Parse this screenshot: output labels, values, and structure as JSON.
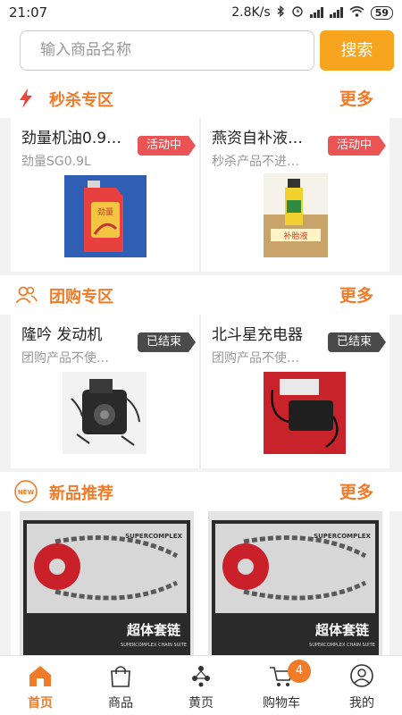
{
  "status_bar": {
    "time": "21:07",
    "speed": "2.8K/s",
    "battery": "59"
  },
  "search": {
    "placeholder": "输入商品名称",
    "button_label": "搜索"
  },
  "flash_sale": {
    "title": "秒杀专区",
    "more": "更多",
    "items": [
      {
        "name": "劲量机油0.9…",
        "subtitle": "劲量SG0.9L",
        "badge": "活动中"
      },
      {
        "name": "燕资自补液…",
        "subtitle": "秒杀产品不进…",
        "badge": "活动中"
      }
    ]
  },
  "group_buy": {
    "title": "团购专区",
    "more": "更多",
    "items": [
      {
        "name": "隆吟 发动机",
        "subtitle": "团购产品不使…",
        "badge": "已结束"
      },
      {
        "name": "北斗星充电器",
        "subtitle": "团购产品不使…",
        "badge": "已结束"
      }
    ]
  },
  "new_products": {
    "title": "新品推荐",
    "more": "更多",
    "icon_text": "NEW",
    "items": [
      {
        "box_title": "超体套链",
        "box_subtitle": "SUPERCOMPLEX CHAIN SUITE",
        "brand": "SUPERCOMPLEX"
      },
      {
        "box_title": "超体套链",
        "box_subtitle": "SUPERCOMPLEX CHAIN SUITE",
        "brand": "SUPERCOMPLEX"
      }
    ]
  },
  "product_labels": {
    "oil_bottle": "劲量",
    "carton": "补胎液"
  },
  "tab_bar": {
    "tabs": [
      {
        "label": "首页",
        "icon": "home-icon",
        "active": true
      },
      {
        "label": "商品",
        "icon": "bag-icon",
        "active": false
      },
      {
        "label": "黄页",
        "icon": "network-icon",
        "active": false
      },
      {
        "label": "购物车",
        "icon": "cart-icon",
        "active": false
      },
      {
        "label": "我的",
        "icon": "user-icon",
        "active": false
      }
    ],
    "cart_count": "4"
  },
  "colors": {
    "accent": "#f07b28",
    "search_button": "#f7a51e",
    "badge_active": "#ea5455",
    "badge_ended": "#4a4a4a"
  }
}
